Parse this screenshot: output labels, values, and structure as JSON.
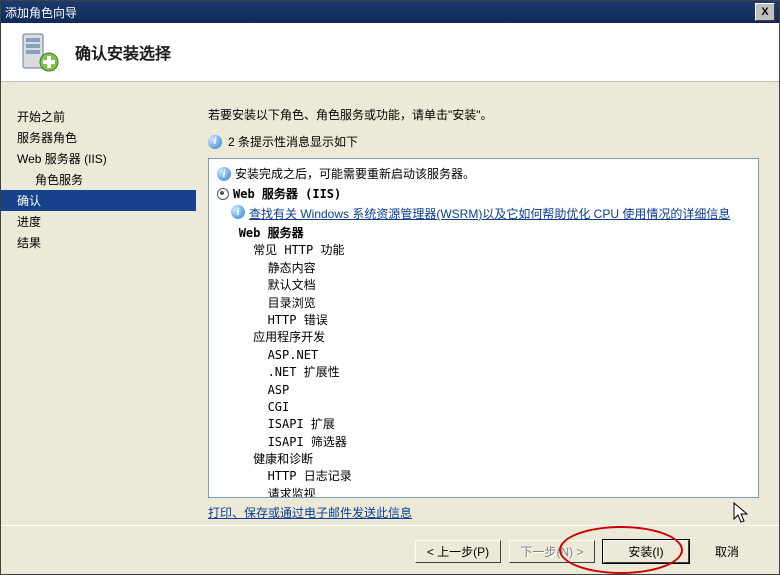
{
  "titlebar": {
    "text": "添加角色向导",
    "close": "X"
  },
  "header": {
    "heading": "确认安装选择"
  },
  "sidebar": {
    "items": [
      {
        "label": "开始之前",
        "indent": false
      },
      {
        "label": "服务器角色",
        "indent": false
      },
      {
        "label": "Web 服务器 (IIS)",
        "indent": false
      },
      {
        "label": "角色服务",
        "indent": true
      },
      {
        "label": "确认",
        "indent": false,
        "selected": true
      },
      {
        "label": "进度",
        "indent": false
      },
      {
        "label": "结果",
        "indent": false
      }
    ]
  },
  "main": {
    "instruction": "若要安装以下角色、角色服务或功能，请单击\"安装\"。",
    "info_count": "2 条提示性消息显示如下",
    "restart_note": "安装完成之后，可能需要重新启动该服务器。",
    "role_name": "Web 服务器 (IIS)",
    "wsrm_link": "查找有关 Windows 系统资源管理器(WSRM)以及它如何帮助优化 CPU 使用情况的详细信息",
    "services": {
      "role": "Web 服务器",
      "g1": "常见 HTTP 功能",
      "g1_items": [
        "静态内容",
        "默认文档",
        "目录浏览",
        "HTTP 错误"
      ],
      "g2": "应用程序开发",
      "g2_items": [
        "ASP.NET",
        ".NET 扩展性",
        "ASP",
        "CGI",
        "ISAPI 扩展",
        "ISAPI 筛选器"
      ],
      "g3": "健康和诊断",
      "g3_items": [
        "HTTP 日志记录",
        "请求监视"
      ]
    },
    "print_link": "打印、保存或通过电子邮件发送此信息"
  },
  "footer": {
    "prev": "< 上一步(P)",
    "next": "下一步(N) >",
    "install": "安装(I)",
    "cancel": "取消"
  }
}
